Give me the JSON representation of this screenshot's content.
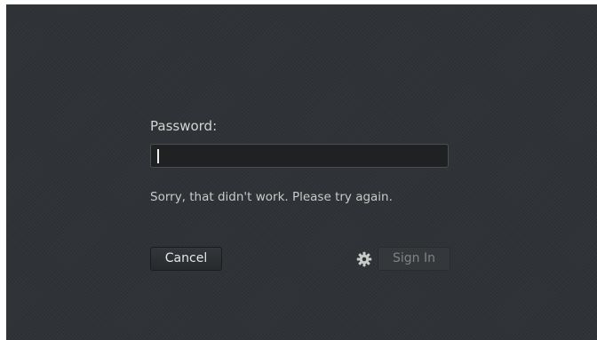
{
  "login": {
    "password_label": "Password:",
    "password_value": "",
    "error_message": "Sorry, that didn't work. Please try again.",
    "cancel_label": "Cancel",
    "signin_label": "Sign In",
    "session_icon": "gear-icon"
  },
  "colors": {
    "background": "#2f3236",
    "text": "#d3d5d3",
    "field_background": "#1f2123",
    "disabled_text": "#7f8481"
  }
}
